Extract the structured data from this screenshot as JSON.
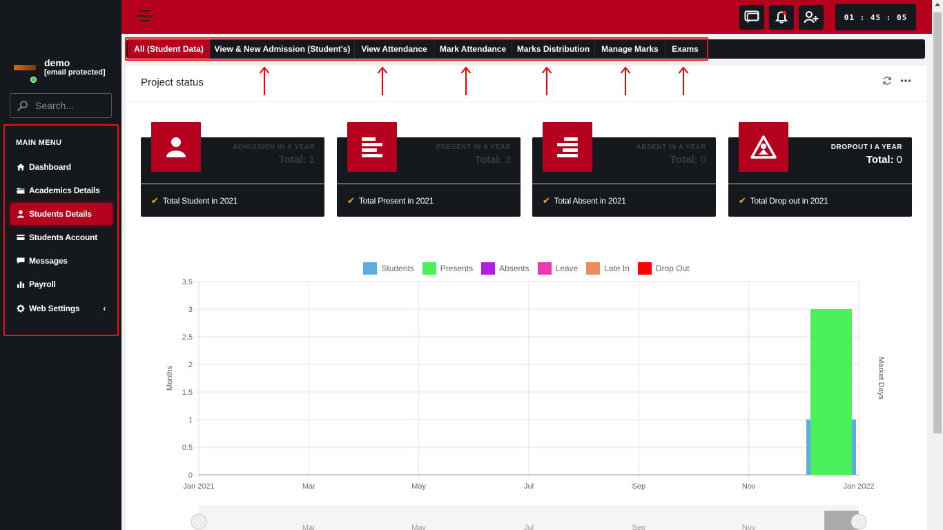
{
  "user": {
    "name": "demo",
    "email": "[email protected]"
  },
  "search": {
    "placeholder": "Search..."
  },
  "menu": {
    "heading": "MAIN MENU",
    "items": [
      {
        "label": "Dashboard",
        "icon": "home-icon"
      },
      {
        "label": "Academics Details",
        "icon": "folder-icon"
      },
      {
        "label": "Students Details",
        "icon": "user-icon",
        "active": true
      },
      {
        "label": "Students Account",
        "icon": "card-icon"
      },
      {
        "label": "Messages",
        "icon": "chat-icon"
      },
      {
        "label": "Payroll",
        "icon": "bar-chart-icon"
      },
      {
        "label": "Web Settings",
        "icon": "gear-icon"
      }
    ]
  },
  "topbar": {
    "clock": "01 : 45 : 05"
  },
  "tabs": [
    "All (Student Data)",
    "View & New Admission (Student's)",
    "View Attendance",
    "Mark Attendance",
    "Marks Distribution",
    "Manage Marks",
    "Exams"
  ],
  "card": {
    "title": "Project status"
  },
  "stats": [
    {
      "label": "ADMISSION IN A YEAR",
      "total_label": "Total:",
      "total_value": "1",
      "footer": "Total Student in 2021",
      "icon": "user-icon",
      "faded": true
    },
    {
      "label": "PRESENT IN A YEAR",
      "total_label": "Total:",
      "total_value": "3",
      "footer": "Total Present in 2021",
      "icon": "align-left-icon",
      "faded": true
    },
    {
      "label": "ABSENT IN A YEAR",
      "total_label": "Total:",
      "total_value": "0",
      "footer": "Total Absent in 2021",
      "icon": "align-right-icon",
      "faded": true
    },
    {
      "label": "DROPOUT I A YEAR",
      "total_label": "Total:",
      "total_value": "0",
      "footer": "Total Drop out in 2021",
      "icon": "warning-icon",
      "faded": false
    }
  ],
  "chart_data": {
    "type": "bar",
    "series": [
      {
        "name": "Students",
        "color": "#5dade2",
        "values": [
          {
            "x": "2021-12",
            "y": 1
          }
        ]
      },
      {
        "name": "Presents",
        "color": "#4cf05a",
        "values": [
          {
            "x": "2021-12",
            "y": 3
          }
        ]
      },
      {
        "name": "Absents",
        "color": "#b31fe0",
        "values": []
      },
      {
        "name": "Leave",
        "color": "#e83cae",
        "values": []
      },
      {
        "name": "Late In",
        "color": "#e88d60",
        "values": []
      },
      {
        "name": "Drop Out",
        "color": "#ff0000",
        "values": []
      }
    ],
    "x_ticks": [
      "Jan 2021",
      "Mar",
      "May",
      "Jul",
      "Sep",
      "Nov",
      "Jan 2022"
    ],
    "y_ticks": [
      "0",
      "0.5",
      "1",
      "1.5",
      "2",
      "2.5",
      "3",
      "3.5"
    ],
    "ylabel": "Months",
    "y2label": "Market Days",
    "ylim": [
      0,
      3.5
    ],
    "navigator_ticks": [
      "Mar",
      "May",
      "Jul",
      "Sep",
      "Nov"
    ],
    "legend_position": "top",
    "grid": true
  }
}
